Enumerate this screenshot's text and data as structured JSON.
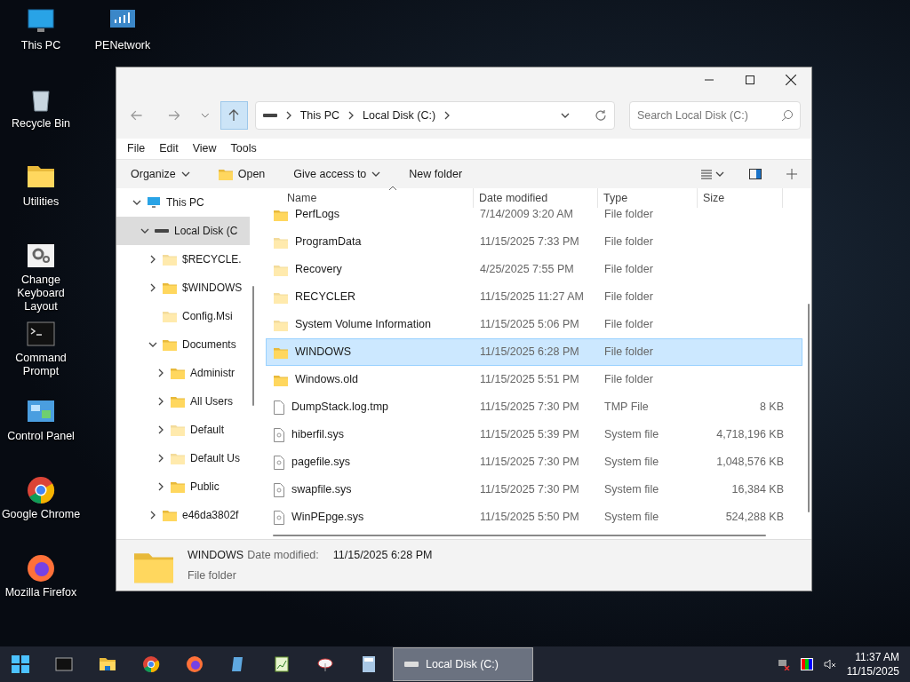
{
  "desktop_icons": [
    {
      "label": "This PC",
      "kind": "pc"
    },
    {
      "label": "PENetwork",
      "kind": "network"
    },
    {
      "label": "Recycle Bin",
      "kind": "bin"
    },
    {
      "label": "Utilities",
      "kind": "folder"
    },
    {
      "label": "Change Keyboard Layout",
      "kind": "gear"
    },
    {
      "label": "Command Prompt",
      "kind": "cmd"
    },
    {
      "label": "Control Panel",
      "kind": "panel"
    },
    {
      "label": "Google Chrome",
      "kind": "chrome"
    },
    {
      "label": "Mozilla Firefox",
      "kind": "firefox"
    }
  ],
  "window": {
    "address": [
      "This PC",
      "Local Disk (C:)"
    ],
    "search": {
      "placeholder": "Search Local Disk (C:)"
    },
    "menu": [
      "File",
      "Edit",
      "View",
      "Tools"
    ],
    "toolbar": [
      {
        "label": "Organize",
        "kind": "dropdown"
      },
      {
        "label": "Open",
        "kind": "open"
      },
      {
        "label": "Give access to",
        "kind": "dropdown"
      },
      {
        "label": "New folder",
        "kind": "plain"
      }
    ],
    "tree": [
      {
        "label": "This PC",
        "kind": "pc",
        "expanded": true,
        "selected": false,
        "children": [
          {
            "label": "Local Disk (C",
            "kind": "drive",
            "expanded": true,
            "selected": true,
            "children": [
              {
                "label": "$RECYCLE.",
                "kind": "folder",
                "expanded": false,
                "selected": false,
                "hidden": true,
                "has_children": true
              },
              {
                "label": "$WINDOWS",
                "kind": "folder",
                "expanded": false,
                "selected": false,
                "hidden": false,
                "has_children": true
              },
              {
                "label": "Config.Msi",
                "kind": "folder",
                "expanded": false,
                "selected": false,
                "hidden": true,
                "has_children": false
              },
              {
                "label": "Documents",
                "kind": "folder",
                "expanded": true,
                "selected": false,
                "hidden": false,
                "children": [
                  {
                    "label": "Administr",
                    "kind": "folder",
                    "expanded": false,
                    "selected": false,
                    "hidden": false,
                    "has_children": true
                  },
                  {
                    "label": "All Users",
                    "kind": "folder",
                    "expanded": false,
                    "selected": false,
                    "hidden": false,
                    "has_children": true
                  },
                  {
                    "label": "Default",
                    "kind": "folder",
                    "expanded": false,
                    "selected": false,
                    "hidden": true,
                    "has_children": true
                  },
                  {
                    "label": "Default Us",
                    "kind": "folder",
                    "expanded": false,
                    "selected": false,
                    "hidden": true,
                    "has_children": true
                  },
                  {
                    "label": "Public",
                    "kind": "folder",
                    "expanded": false,
                    "selected": false,
                    "hidden": false,
                    "has_children": true
                  }
                ]
              },
              {
                "label": "e46da3802f",
                "kind": "folder",
                "expanded": false,
                "selected": false,
                "hidden": false,
                "has_children": true
              }
            ]
          }
        ]
      }
    ],
    "columns": [
      "Name",
      "Date modified",
      "Type",
      "Size"
    ],
    "rows": [
      {
        "name": "PerfLogs",
        "date": "7/14/2009 3:20 AM",
        "type": "File folder",
        "size": "",
        "kind": "folder",
        "hidden": false,
        "selected": false
      },
      {
        "name": "ProgramData",
        "date": "11/15/2025 7:33 PM",
        "type": "File folder",
        "size": "",
        "kind": "folder",
        "hidden": true,
        "selected": false
      },
      {
        "name": "Recovery",
        "date": "4/25/2025 7:55 PM",
        "type": "File folder",
        "size": "",
        "kind": "folder",
        "hidden": true,
        "selected": false
      },
      {
        "name": "RECYCLER",
        "date": "11/15/2025 11:27 AM",
        "type": "File folder",
        "size": "",
        "kind": "folder",
        "hidden": true,
        "selected": false
      },
      {
        "name": "System Volume Information",
        "date": "11/15/2025 5:06 PM",
        "type": "File folder",
        "size": "",
        "kind": "folder",
        "hidden": true,
        "selected": false
      },
      {
        "name": "WINDOWS",
        "date": "11/15/2025 6:28 PM",
        "type": "File folder",
        "size": "",
        "kind": "folder",
        "hidden": false,
        "selected": true
      },
      {
        "name": "Windows.old",
        "date": "11/15/2025 5:51 PM",
        "type": "File folder",
        "size": "",
        "kind": "folder",
        "hidden": false,
        "selected": false
      },
      {
        "name": "DumpStack.log.tmp",
        "date": "11/15/2025 7:30 PM",
        "type": "TMP File",
        "size": "8 KB",
        "kind": "file",
        "hidden": false,
        "selected": false
      },
      {
        "name": "hiberfil.sys",
        "date": "11/15/2025 5:39 PM",
        "type": "System file",
        "size": "4,718,196 KB",
        "kind": "system",
        "hidden": false,
        "selected": false
      },
      {
        "name": "pagefile.sys",
        "date": "11/15/2025 7:30 PM",
        "type": "System file",
        "size": "1,048,576 KB",
        "kind": "system",
        "hidden": false,
        "selected": false
      },
      {
        "name": "swapfile.sys",
        "date": "11/15/2025 7:30 PM",
        "type": "System file",
        "size": "16,384 KB",
        "kind": "system",
        "hidden": false,
        "selected": false
      },
      {
        "name": "WinPEpge.sys",
        "date": "11/15/2025 5:50 PM",
        "type": "System file",
        "size": "524,288 KB",
        "kind": "system",
        "hidden": false,
        "selected": false
      }
    ],
    "details": {
      "name": "WINDOWS",
      "date_label": "Date modified:",
      "date": "11/15/2025 6:28 PM",
      "type": "File folder"
    }
  },
  "taskbar": {
    "active_window": {
      "label": "Local Disk (C:)",
      "selected": true
    },
    "time": "11:37 AM",
    "date": "11/15/2025"
  }
}
